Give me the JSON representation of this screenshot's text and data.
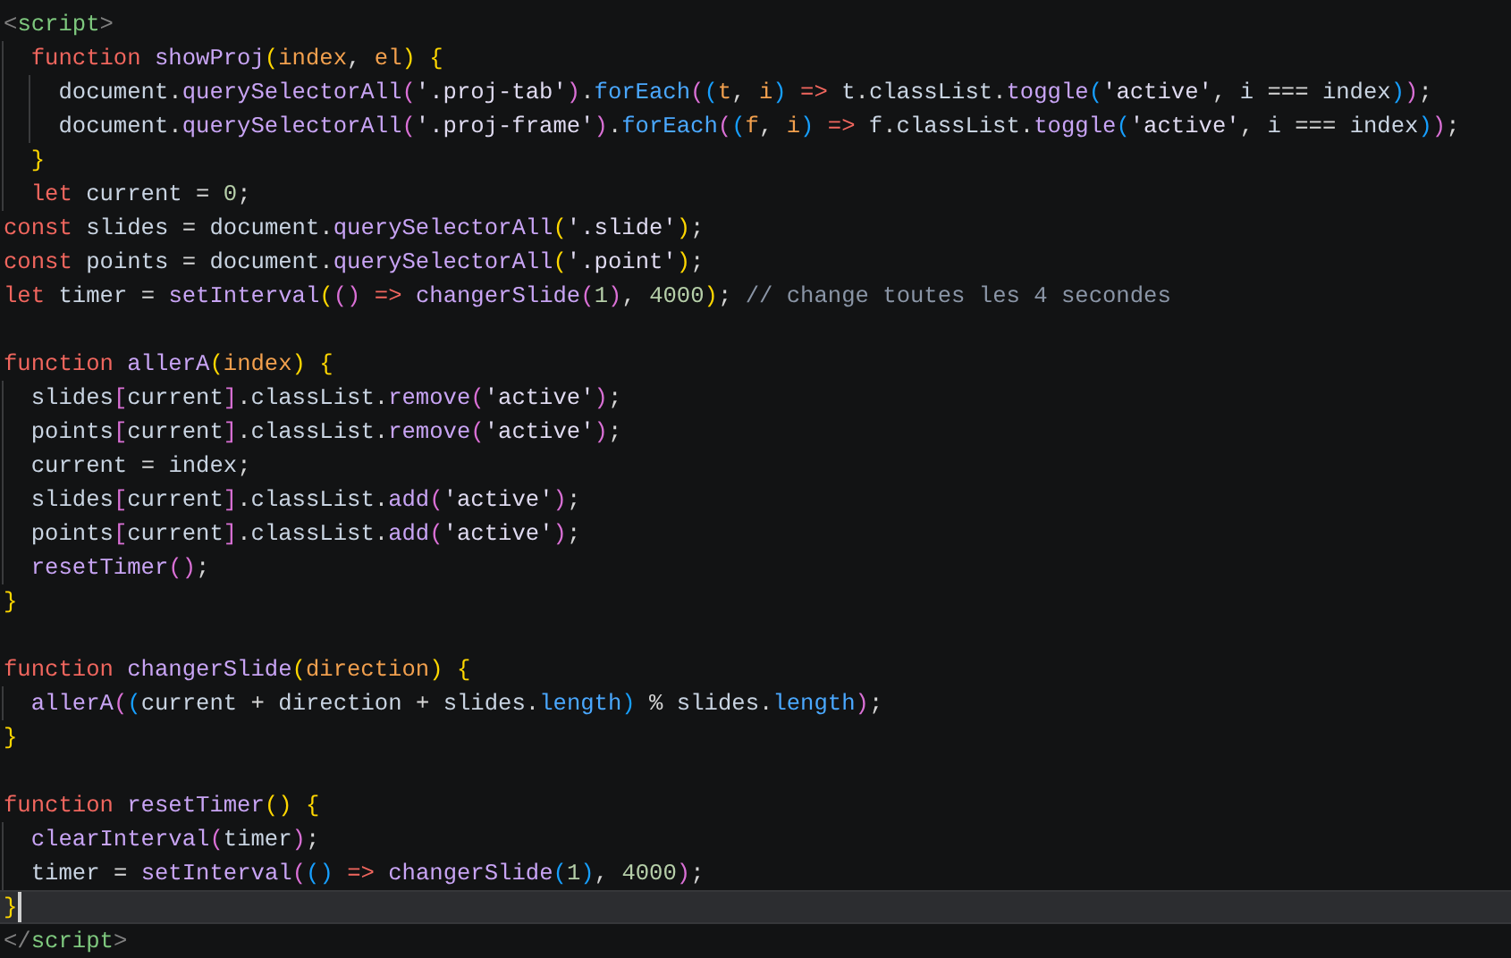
{
  "editor": {
    "lines": [
      {
        "current": false,
        "tokens": [
          {
            "text": "<",
            "kind": "tag"
          },
          {
            "text": "script",
            "kind": "tagname"
          },
          {
            "text": ">",
            "kind": "tag"
          }
        ]
      },
      {
        "current": false,
        "tokens": [
          {
            "text": "  function",
            "kind": "kw"
          },
          {
            "text": " showProj",
            "kind": "fn"
          },
          {
            "text": "(",
            "kind": "p"
          },
          {
            "text": "index",
            "kind": "param"
          },
          {
            "text": ", ",
            "kind": "p"
          },
          {
            "text": "el",
            "kind": "param"
          },
          {
            "text": ") {",
            "kind": "p"
          }
        ]
      },
      {
        "current": false,
        "tokens": [
          {
            "text": "    document",
            "kind": "var"
          },
          {
            "text": ".",
            "kind": "p"
          },
          {
            "text": "querySelectorAll",
            "kind": "fn"
          },
          {
            "text": "(",
            "kind": "p"
          },
          {
            "text": "'.proj-tab'",
            "kind": "str"
          },
          {
            "text": ").",
            "kind": "p"
          },
          {
            "text": "forEach",
            "kind": "prop"
          },
          {
            "text": "((",
            "kind": "p"
          },
          {
            "text": "t",
            "kind": "param"
          },
          {
            "text": ", ",
            "kind": "p"
          },
          {
            "text": "i",
            "kind": "param"
          },
          {
            "text": ") ",
            "kind": "p"
          },
          {
            "text": "=>",
            "kind": "kw"
          },
          {
            "text": " t",
            "kind": "var"
          },
          {
            "text": ".",
            "kind": "p"
          },
          {
            "text": "classList",
            "kind": "var"
          },
          {
            "text": ".",
            "kind": "p"
          },
          {
            "text": "toggle",
            "kind": "fn"
          },
          {
            "text": "(",
            "kind": "p"
          },
          {
            "text": "'active'",
            "kind": "str"
          },
          {
            "text": ", ",
            "kind": "p"
          },
          {
            "text": "i",
            "kind": "var"
          },
          {
            "text": " === ",
            "kind": "p"
          },
          {
            "text": "index",
            "kind": "var"
          },
          {
            "text": "));",
            "kind": "p"
          }
        ]
      },
      {
        "current": false,
        "tokens": [
          {
            "text": "    document",
            "kind": "var"
          },
          {
            "text": ".",
            "kind": "p"
          },
          {
            "text": "querySelectorAll",
            "kind": "fn"
          },
          {
            "text": "(",
            "kind": "p"
          },
          {
            "text": "'.proj-frame'",
            "kind": "str"
          },
          {
            "text": ").",
            "kind": "p"
          },
          {
            "text": "forEach",
            "kind": "prop"
          },
          {
            "text": "((",
            "kind": "p"
          },
          {
            "text": "f",
            "kind": "param"
          },
          {
            "text": ", ",
            "kind": "p"
          },
          {
            "text": "i",
            "kind": "param"
          },
          {
            "text": ") ",
            "kind": "p"
          },
          {
            "text": "=>",
            "kind": "kw"
          },
          {
            "text": " f",
            "kind": "var"
          },
          {
            "text": ".",
            "kind": "p"
          },
          {
            "text": "classList",
            "kind": "var"
          },
          {
            "text": ".",
            "kind": "p"
          },
          {
            "text": "toggle",
            "kind": "fn"
          },
          {
            "text": "(",
            "kind": "p"
          },
          {
            "text": "'active'",
            "kind": "str"
          },
          {
            "text": ", ",
            "kind": "p"
          },
          {
            "text": "i",
            "kind": "var"
          },
          {
            "text": " === ",
            "kind": "p"
          },
          {
            "text": "index",
            "kind": "var"
          },
          {
            "text": "));",
            "kind": "p"
          }
        ]
      },
      {
        "current": false,
        "tokens": [
          {
            "text": "  }",
            "kind": "p"
          }
        ]
      },
      {
        "current": false,
        "tokens": [
          {
            "text": "  let",
            "kind": "kw"
          },
          {
            "text": " current",
            "kind": "var"
          },
          {
            "text": " = ",
            "kind": "p"
          },
          {
            "text": "0",
            "kind": "num"
          },
          {
            "text": ";",
            "kind": "p"
          }
        ]
      },
      {
        "current": false,
        "tokens": [
          {
            "text": "const",
            "kind": "kw"
          },
          {
            "text": " slides",
            "kind": "var"
          },
          {
            "text": " = ",
            "kind": "p"
          },
          {
            "text": "document",
            "kind": "var"
          },
          {
            "text": ".",
            "kind": "p"
          },
          {
            "text": "querySelectorAll",
            "kind": "fn"
          },
          {
            "text": "(",
            "kind": "p"
          },
          {
            "text": "'.slide'",
            "kind": "str"
          },
          {
            "text": ");",
            "kind": "p"
          }
        ]
      },
      {
        "current": false,
        "tokens": [
          {
            "text": "const",
            "kind": "kw"
          },
          {
            "text": " points",
            "kind": "var"
          },
          {
            "text": " = ",
            "kind": "p"
          },
          {
            "text": "document",
            "kind": "var"
          },
          {
            "text": ".",
            "kind": "p"
          },
          {
            "text": "querySelectorAll",
            "kind": "fn"
          },
          {
            "text": "(",
            "kind": "p"
          },
          {
            "text": "'.point'",
            "kind": "str"
          },
          {
            "text": ");",
            "kind": "p"
          }
        ]
      },
      {
        "current": false,
        "tokens": [
          {
            "text": "let",
            "kind": "kw"
          },
          {
            "text": " timer",
            "kind": "var"
          },
          {
            "text": " = ",
            "kind": "p"
          },
          {
            "text": "setInterval",
            "kind": "fn"
          },
          {
            "text": "(() ",
            "kind": "p"
          },
          {
            "text": "=>",
            "kind": "kw"
          },
          {
            "text": " changerSlide",
            "kind": "fn"
          },
          {
            "text": "(",
            "kind": "p"
          },
          {
            "text": "1",
            "kind": "num"
          },
          {
            "text": "), ",
            "kind": "p"
          },
          {
            "text": "4000",
            "kind": "num"
          },
          {
            "text": "); ",
            "kind": "p"
          },
          {
            "text": "// change toutes les 4 secondes",
            "kind": "cmt"
          }
        ]
      },
      {
        "current": false
      },
      {
        "current": false,
        "tokens": [
          {
            "text": "function",
            "kind": "kw"
          },
          {
            "text": " allerA",
            "kind": "fn"
          },
          {
            "text": "(",
            "kind": "p"
          },
          {
            "text": "index",
            "kind": "param"
          },
          {
            "text": ") {",
            "kind": "p"
          }
        ]
      },
      {
        "current": false,
        "tokens": [
          {
            "text": "  slides",
            "kind": "var"
          },
          {
            "text": "[",
            "kind": "p"
          },
          {
            "text": "current",
            "kind": "var"
          },
          {
            "text": "].",
            "kind": "p"
          },
          {
            "text": "classList",
            "kind": "var"
          },
          {
            "text": ".",
            "kind": "p"
          },
          {
            "text": "remove",
            "kind": "fn"
          },
          {
            "text": "(",
            "kind": "p"
          },
          {
            "text": "'active'",
            "kind": "str"
          },
          {
            "text": ");",
            "kind": "p"
          }
        ]
      },
      {
        "current": false,
        "tokens": [
          {
            "text": "  points",
            "kind": "var"
          },
          {
            "text": "[",
            "kind": "p"
          },
          {
            "text": "current",
            "kind": "var"
          },
          {
            "text": "].",
            "kind": "p"
          },
          {
            "text": "classList",
            "kind": "var"
          },
          {
            "text": ".",
            "kind": "p"
          },
          {
            "text": "remove",
            "kind": "fn"
          },
          {
            "text": "(",
            "kind": "p"
          },
          {
            "text": "'active'",
            "kind": "str"
          },
          {
            "text": ");",
            "kind": "p"
          }
        ]
      },
      {
        "current": false,
        "tokens": [
          {
            "text": "  current",
            "kind": "var"
          },
          {
            "text": " = ",
            "kind": "p"
          },
          {
            "text": "index",
            "kind": "var"
          },
          {
            "text": ";",
            "kind": "p"
          }
        ]
      },
      {
        "current": false,
        "tokens": [
          {
            "text": "  slides",
            "kind": "var"
          },
          {
            "text": "[",
            "kind": "p"
          },
          {
            "text": "current",
            "kind": "var"
          },
          {
            "text": "].",
            "kind": "p"
          },
          {
            "text": "classList",
            "kind": "var"
          },
          {
            "text": ".",
            "kind": "p"
          },
          {
            "text": "add",
            "kind": "fn"
          },
          {
            "text": "(",
            "kind": "p"
          },
          {
            "text": "'active'",
            "kind": "str"
          },
          {
            "text": ");",
            "kind": "p"
          }
        ]
      },
      {
        "current": false,
        "tokens": [
          {
            "text": "  points",
            "kind": "var"
          },
          {
            "text": "[",
            "kind": "p"
          },
          {
            "text": "current",
            "kind": "var"
          },
          {
            "text": "].",
            "kind": "p"
          },
          {
            "text": "classList",
            "kind": "var"
          },
          {
            "text": ".",
            "kind": "p"
          },
          {
            "text": "add",
            "kind": "fn"
          },
          {
            "text": "(",
            "kind": "p"
          },
          {
            "text": "'active'",
            "kind": "str"
          },
          {
            "text": ");",
            "kind": "p"
          }
        ]
      },
      {
        "current": false,
        "tokens": [
          {
            "text": "  resetTimer",
            "kind": "fn"
          },
          {
            "text": "();",
            "kind": "p"
          }
        ]
      },
      {
        "current": false,
        "tokens": [
          {
            "text": "}",
            "kind": "p"
          }
        ]
      },
      {
        "current": false
      },
      {
        "current": false,
        "tokens": [
          {
            "text": "function",
            "kind": "kw"
          },
          {
            "text": " changerSlide",
            "kind": "fn"
          },
          {
            "text": "(",
            "kind": "p"
          },
          {
            "text": "direction",
            "kind": "param"
          },
          {
            "text": ") {",
            "kind": "p"
          }
        ]
      },
      {
        "current": false,
        "tokens": [
          {
            "text": "  allerA",
            "kind": "fn"
          },
          {
            "text": "((",
            "kind": "p"
          },
          {
            "text": "current",
            "kind": "var"
          },
          {
            "text": " + ",
            "kind": "p"
          },
          {
            "text": "direction",
            "kind": "var"
          },
          {
            "text": " + ",
            "kind": "p"
          },
          {
            "text": "slides",
            "kind": "var"
          },
          {
            "text": ".",
            "kind": "p"
          },
          {
            "text": "length",
            "kind": "prop"
          },
          {
            "text": ") % ",
            "kind": "p"
          },
          {
            "text": "slides",
            "kind": "var"
          },
          {
            "text": ".",
            "kind": "p"
          },
          {
            "text": "length",
            "kind": "prop"
          },
          {
            "text": ");",
            "kind": "p"
          }
        ]
      },
      {
        "current": false,
        "tokens": [
          {
            "text": "}",
            "kind": "p"
          }
        ]
      },
      {
        "current": false
      },
      {
        "current": false,
        "tokens": [
          {
            "text": "function",
            "kind": "kw"
          },
          {
            "text": " resetTimer",
            "kind": "fn"
          },
          {
            "text": "() {",
            "kind": "p"
          }
        ]
      },
      {
        "current": false,
        "tokens": [
          {
            "text": "  clearInterval",
            "kind": "fn"
          },
          {
            "text": "(",
            "kind": "p"
          },
          {
            "text": "timer",
            "kind": "var"
          },
          {
            "text": ");",
            "kind": "p"
          }
        ]
      },
      {
        "current": false,
        "tokens": [
          {
            "text": "  timer",
            "kind": "var"
          },
          {
            "text": " = ",
            "kind": "p"
          },
          {
            "text": "setInterval",
            "kind": "fn"
          },
          {
            "text": "(() ",
            "kind": "p"
          },
          {
            "text": "=>",
            "kind": "kw"
          },
          {
            "text": " changerSlide",
            "kind": "fn"
          },
          {
            "text": "(",
            "kind": "p"
          },
          {
            "text": "1",
            "kind": "num"
          },
          {
            "text": "), ",
            "kind": "p"
          },
          {
            "text": "4000",
            "kind": "num"
          },
          {
            "text": ");",
            "kind": "p"
          }
        ]
      },
      {
        "current": true,
        "tokens": [
          {
            "text": "}",
            "kind": "p"
          }
        ]
      },
      {
        "current": false,
        "tokens": [
          {
            "text": "</",
            "kind": "tag"
          },
          {
            "text": "script",
            "kind": "tagname"
          },
          {
            "text": ">",
            "kind": "tag"
          }
        ]
      }
    ]
  }
}
